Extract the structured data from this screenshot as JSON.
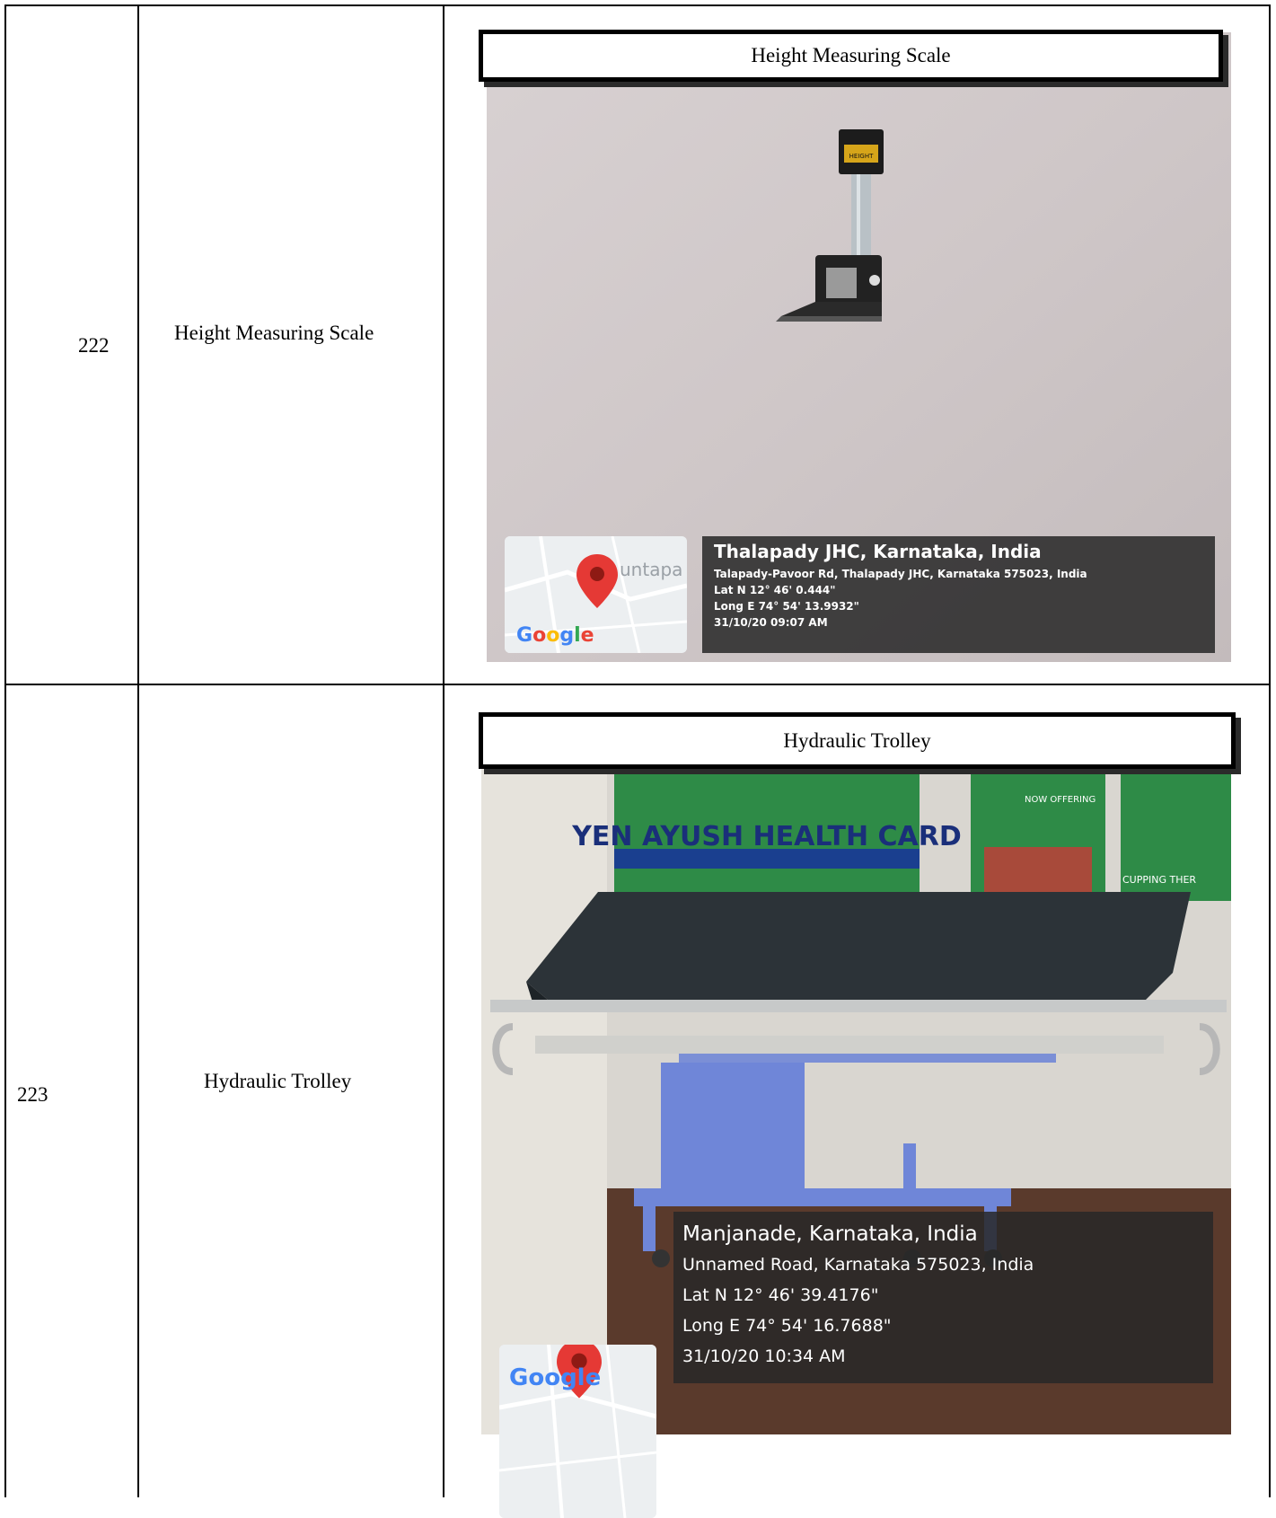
{
  "rows": [
    {
      "number": "222",
      "item_name": "Height Measuring Scale",
      "caption": "Height Measuring Scale",
      "map_place_fragment": "untapa",
      "map_brand": "Google",
      "geotag": {
        "title": "Thalapady JHC, Karnataka, India",
        "address": "Talapady-Pavoor Rd, Thalapady JHC, Karnataka 575023, India",
        "lat": "Lat N 12° 46' 0.444\"",
        "long": "Long E 74° 54' 13.9932\"",
        "datetime": "31/10/20 09:07 AM"
      },
      "device_label": "HEIGHT"
    },
    {
      "number": "223",
      "item_name": "Hydraulic Trolley",
      "caption": "Hydraulic Trolley",
      "map_brand": "Google",
      "geotag": {
        "title": "Manjanade, Karnataka, India",
        "address": "Unnamed Road, Karnataka 575023, India",
        "lat": "Lat N 12° 46' 39.4176\"",
        "long": "Long E 74° 54' 16.7688\"",
        "datetime": "31/10/20 10:34 AM"
      },
      "banner": {
        "title": "YEN AYUSH HEALTH CARD",
        "side_left": "NOW OFFERING",
        "side_right": "CUPPING THER"
      }
    }
  ]
}
